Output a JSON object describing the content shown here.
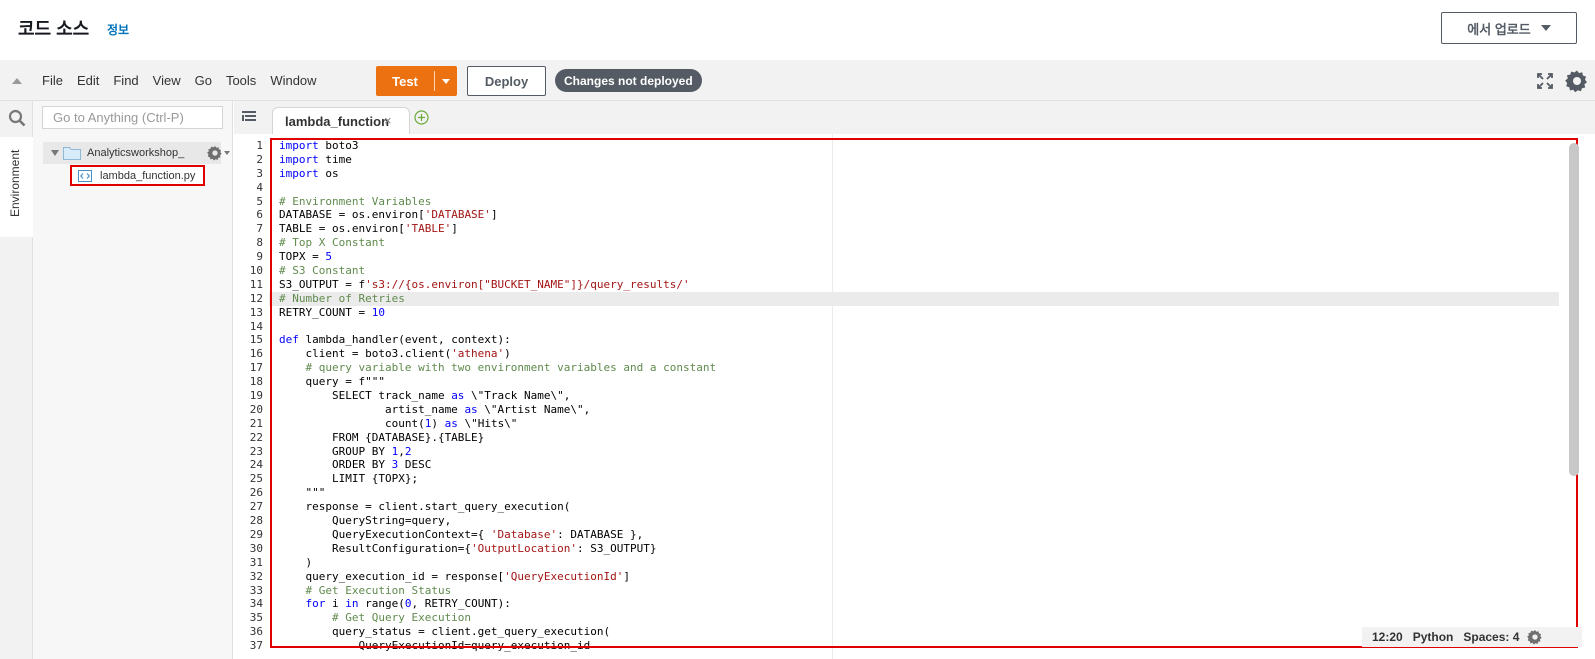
{
  "header": {
    "title": "코드 소스",
    "info_link": "정보",
    "upload_button": "에서 업로드"
  },
  "toolbar": {
    "menu": [
      "File",
      "Edit",
      "Find",
      "View",
      "Go",
      "Tools",
      "Window"
    ],
    "test_button": "Test",
    "deploy_button": "Deploy",
    "status_badge": "Changes not deployed"
  },
  "sidebar": {
    "environment_tab": "Environment",
    "search_placeholder": "Go to Anything (Ctrl-P)",
    "folder_name": "Analyticsworkshop_",
    "file_name": "lambda_function.py"
  },
  "editor": {
    "tab_label": "lambda_function",
    "tab_close": "×",
    "active_line": 12,
    "lines": [
      "import boto3",
      "import time",
      "import os",
      "",
      "# Environment Variables",
      "DATABASE = os.environ['DATABASE']",
      "TABLE = os.environ['TABLE']",
      "# Top X Constant",
      "TOPX = 5",
      "# S3 Constant",
      "S3_OUTPUT = f's3://{os.environ[\"BUCKET_NAME\"]}/query_results/'",
      "# Number of Retries",
      "RETRY_COUNT = 10",
      "",
      "def lambda_handler(event, context):",
      "    client = boto3.client('athena')",
      "    # query variable with two environment variables and a constant",
      "    query = f\"\"\"",
      "        SELECT track_name as \\\"Track Name\\\",",
      "                artist_name as \\\"Artist Name\\\",",
      "                count(1) as \\\"Hits\\\"",
      "        FROM {DATABASE}.{TABLE}",
      "        GROUP BY 1,2",
      "        ORDER BY 3 DESC",
      "        LIMIT {TOPX};",
      "    \"\"\"",
      "    response = client.start_query_execution(",
      "        QueryString=query,",
      "        QueryExecutionContext={ 'Database': DATABASE },",
      "        ResultConfiguration={'OutputLocation': S3_OUTPUT}",
      "    )",
      "    query_execution_id = response['QueryExecutionId']",
      "    # Get Execution Status",
      "    for i in range(0, RETRY_COUNT):",
      "        # Get Query Execution",
      "        query_status = client.get_query_execution(",
      "            QueryExecutionId=query_execution_id"
    ]
  },
  "statusbar": {
    "cursor": "12:20",
    "language": "Python",
    "indent": "Spaces: 4"
  },
  "colors": {
    "accent_orange": "#ec7211",
    "highlight_red": "#e00000",
    "link_blue": "#0073bb",
    "keyword_blue": "#0000ff",
    "comment_gray": "#608b4e",
    "string_color": "#a31515"
  }
}
